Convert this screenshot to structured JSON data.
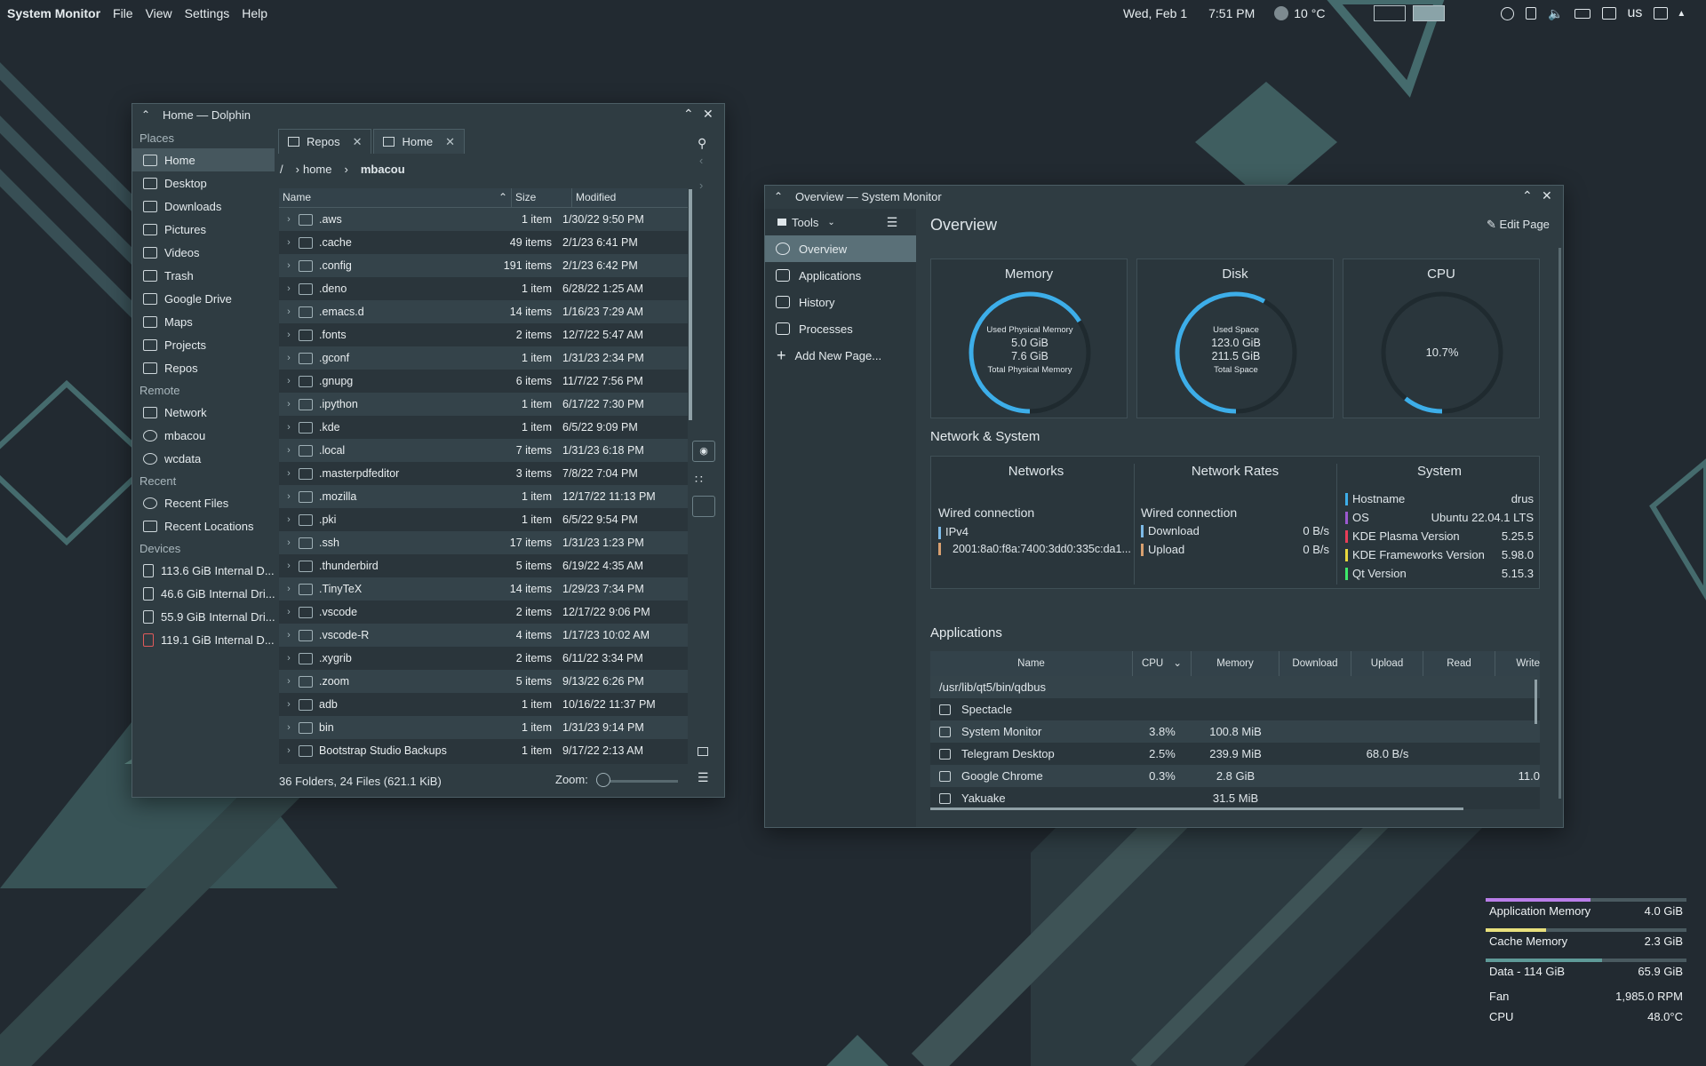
{
  "topbar": {
    "app": "System Monitor",
    "menus": [
      "File",
      "View",
      "Settings",
      "Help"
    ],
    "date": "Wed, Feb 1",
    "time": "7:51 PM",
    "weather": "10 °C",
    "keyboard_layout": "us"
  },
  "dolphin": {
    "title": "Home — Dolphin",
    "places_header": "Places",
    "places": [
      "Home",
      "Desktop",
      "Downloads",
      "Pictures",
      "Videos",
      "Trash",
      "Google Drive",
      "Maps",
      "Projects",
      "Repos"
    ],
    "remote_header": "Remote",
    "remote": [
      "Network",
      "mbacou",
      "wcdata"
    ],
    "recent_header": "Recent",
    "recent": [
      "Recent Files",
      "Recent Locations"
    ],
    "devices_header": "Devices",
    "devices": [
      "113.6 GiB Internal D...",
      "46.6 GiB Internal Dri...",
      "55.9 GiB Internal Dri...",
      "119.1 GiB Internal D..."
    ],
    "tabs": [
      "Repos",
      "Home"
    ],
    "breadcrumb": [
      "/",
      "home",
      "mbacou"
    ],
    "columns": [
      "Name",
      "Size",
      "Modified"
    ],
    "files": [
      {
        "name": ".aws",
        "size": "1 item",
        "modified": "1/30/22 9:50 PM"
      },
      {
        "name": ".cache",
        "size": "49 items",
        "modified": "2/1/23 6:41 PM"
      },
      {
        "name": ".config",
        "size": "191 items",
        "modified": "2/1/23 6:42 PM"
      },
      {
        "name": ".deno",
        "size": "1 item",
        "modified": "6/28/22 1:25 AM"
      },
      {
        "name": ".emacs.d",
        "size": "14 items",
        "modified": "1/16/23 7:29 AM"
      },
      {
        "name": ".fonts",
        "size": "2 items",
        "modified": "12/7/22 5:47 AM"
      },
      {
        "name": ".gconf",
        "size": "1 item",
        "modified": "1/31/23 2:34 PM"
      },
      {
        "name": ".gnupg",
        "size": "6 items",
        "modified": "11/7/22 7:56 PM"
      },
      {
        "name": ".ipython",
        "size": "1 item",
        "modified": "6/17/22 7:30 PM"
      },
      {
        "name": ".kde",
        "size": "1 item",
        "modified": "6/5/22 9:09 PM"
      },
      {
        "name": ".local",
        "size": "7 items",
        "modified": "1/31/23 6:18 PM"
      },
      {
        "name": ".masterpdfeditor",
        "size": "3 items",
        "modified": "7/8/22 7:04 PM"
      },
      {
        "name": ".mozilla",
        "size": "1 item",
        "modified": "12/17/22 11:13 PM"
      },
      {
        "name": ".pki",
        "size": "1 item",
        "modified": "6/5/22 9:54 PM"
      },
      {
        "name": ".ssh",
        "size": "17 items",
        "modified": "1/31/23 1:23 PM"
      },
      {
        "name": ".thunderbird",
        "size": "5 items",
        "modified": "6/19/22 4:35 AM"
      },
      {
        "name": ".TinyTeX",
        "size": "14 items",
        "modified": "1/29/23 7:34 PM"
      },
      {
        "name": ".vscode",
        "size": "2 items",
        "modified": "12/17/22 9:06 PM"
      },
      {
        "name": ".vscode-R",
        "size": "4 items",
        "modified": "1/17/23 10:02 AM"
      },
      {
        "name": ".xygrib",
        "size": "2 items",
        "modified": "6/11/22 3:34 PM"
      },
      {
        "name": ".zoom",
        "size": "5 items",
        "modified": "9/13/22 6:26 PM"
      },
      {
        "name": "adb",
        "size": "1 item",
        "modified": "10/16/22 11:37 PM"
      },
      {
        "name": "bin",
        "size": "1 item",
        "modified": "1/31/23 9:14 PM"
      },
      {
        "name": "Bootstrap Studio Backups",
        "size": "1 item",
        "modified": "9/17/22 2:13 AM"
      }
    ],
    "status": "36 Folders, 24 Files (621.1 KiB)",
    "zoom_label": "Zoom:"
  },
  "sysmon": {
    "title": "Overview — System Monitor",
    "tools": "Tools",
    "pages": [
      "Overview",
      "Applications",
      "History",
      "Processes",
      "Add New Page..."
    ],
    "page_title": "Overview",
    "edit_page": "Edit Page",
    "memory": {
      "title": "Memory",
      "used_label": "Used Physical Memory",
      "used": "5.0 GiB",
      "total": "7.6 GiB",
      "total_label": "Total Physical Memory",
      "fraction": 0.66
    },
    "disk": {
      "title": "Disk",
      "used_label": "Used Space",
      "used": "123.0 GiB",
      "total": "211.5 GiB",
      "total_label": "Total Space",
      "fraction": 0.58
    },
    "cpu": {
      "title": "CPU",
      "value": "10.7%",
      "fraction": 0.107
    },
    "network_section": "Network & System",
    "networks": {
      "title": "Networks",
      "conn": "Wired connection",
      "proto": "IPv4",
      "addr": "2001:8a0:f8a:7400:3dd0:335c:da1..."
    },
    "rates": {
      "title": "Network Rates",
      "conn": "Wired connection",
      "download_label": "Download",
      "download": "0 B/s",
      "upload_label": "Upload",
      "upload": "0 B/s"
    },
    "system": {
      "title": "System",
      "rows": [
        {
          "k": "Hostname",
          "v": "drus",
          "color": "#3daee9"
        },
        {
          "k": "OS",
          "v": "Ubuntu 22.04.1 LTS",
          "color": "#9b59d0"
        },
        {
          "k": "KDE Plasma Version",
          "v": "5.25.5",
          "color": "#e93d58"
        },
        {
          "k": "KDE Frameworks Version",
          "v": "5.98.0",
          "color": "#e9d83d"
        },
        {
          "k": "Qt Version",
          "v": "5.15.3",
          "color": "#3de96a"
        }
      ]
    },
    "apps_section": "Applications",
    "app_columns": [
      "Name",
      "CPU",
      "Memory",
      "Download",
      "Upload",
      "Read",
      "Write"
    ],
    "apps": [
      {
        "name": "/usr/lib/qt5/bin/qdbus",
        "cpu": "",
        "mem": "",
        "up": "",
        "write": ""
      },
      {
        "name": "Spectacle",
        "cpu": "",
        "mem": "",
        "up": "",
        "write": ""
      },
      {
        "name": "System Monitor",
        "cpu": "3.8%",
        "mem": "100.8 MiB",
        "up": "",
        "write": ""
      },
      {
        "name": "Telegram Desktop",
        "cpu": "2.5%",
        "mem": "239.9 MiB",
        "up": "68.0 B/s",
        "write": ""
      },
      {
        "name": "Google Chrome",
        "cpu": "0.3%",
        "mem": "2.8 GiB",
        "up": "",
        "write": "11.0"
      },
      {
        "name": "Yakuake",
        "cpu": "",
        "mem": "31.5 MiB",
        "up": "",
        "write": ""
      }
    ]
  },
  "widget": {
    "rows": [
      {
        "label": "Application Memory",
        "value": "4.0 GiB",
        "fraction": 0.52,
        "color": "#b97de8"
      },
      {
        "label": "Cache Memory",
        "value": "2.3 GiB",
        "fraction": 0.3,
        "color": "#e8e07d"
      },
      {
        "label": "Data - 114 GiB",
        "value": "65.9 GiB",
        "fraction": 0.58,
        "color": "#5f9a98"
      }
    ],
    "fan_label": "Fan",
    "fan": "1,985.0 RPM",
    "cpu_label": "CPU",
    "cpu": "48.0°C"
  }
}
